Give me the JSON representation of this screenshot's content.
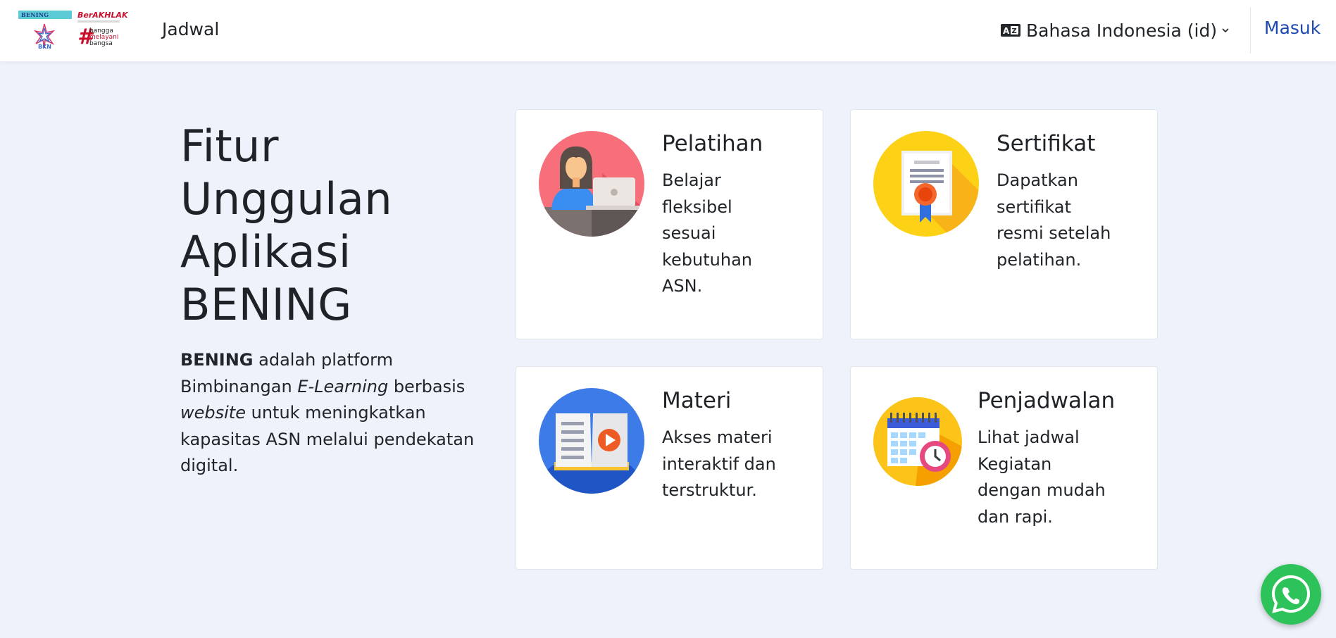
{
  "brand": {
    "logo_bening_text": "BENING",
    "logo_bkn_text": "BKN",
    "logo_berakhlak_text": "BerAKHLAK",
    "logo_bangga_lines": [
      "bangga",
      "melayani",
      "bangsa"
    ]
  },
  "nav": {
    "jadwal_label": "Jadwal",
    "language_label": "Bahasa Indonesia (id)",
    "login_label": "Masuk"
  },
  "hero": {
    "title_lines": [
      "Fitur",
      "Unggulan",
      "Aplikasi",
      "BENING"
    ],
    "desc_bold": "BENING",
    "desc_part1": " adalah platform Bimbinangan ",
    "desc_italic1": "E-Learning",
    "desc_part2": " berbasis ",
    "desc_italic2": "website",
    "desc_part3": " untuk meningkatkan kapasitas ASN melalui pendekatan digital."
  },
  "features": [
    {
      "title": "Pelatihan",
      "text": "Belajar fleksibel sesuai kebutuhan ASN.",
      "icon": "trainee-laptop-icon"
    },
    {
      "title": "Sertifikat",
      "text": "Dapatkan sertifikat resmi setelah pelatihan.",
      "icon": "certificate-icon"
    },
    {
      "title": "Materi",
      "text": "Akses materi interaktif dan terstruktur.",
      "icon": "book-video-icon"
    },
    {
      "title": "Penjadwalan",
      "text": "Lihat jadwal Kegiatan dengan mudah dan rapi.",
      "icon": "calendar-clock-icon"
    }
  ],
  "colors": {
    "page_background": "#eef2fa",
    "link_blue": "#1d49b0",
    "whatsapp_green": "#2ec35a"
  },
  "whatsapp": {
    "icon": "whatsapp-icon"
  }
}
